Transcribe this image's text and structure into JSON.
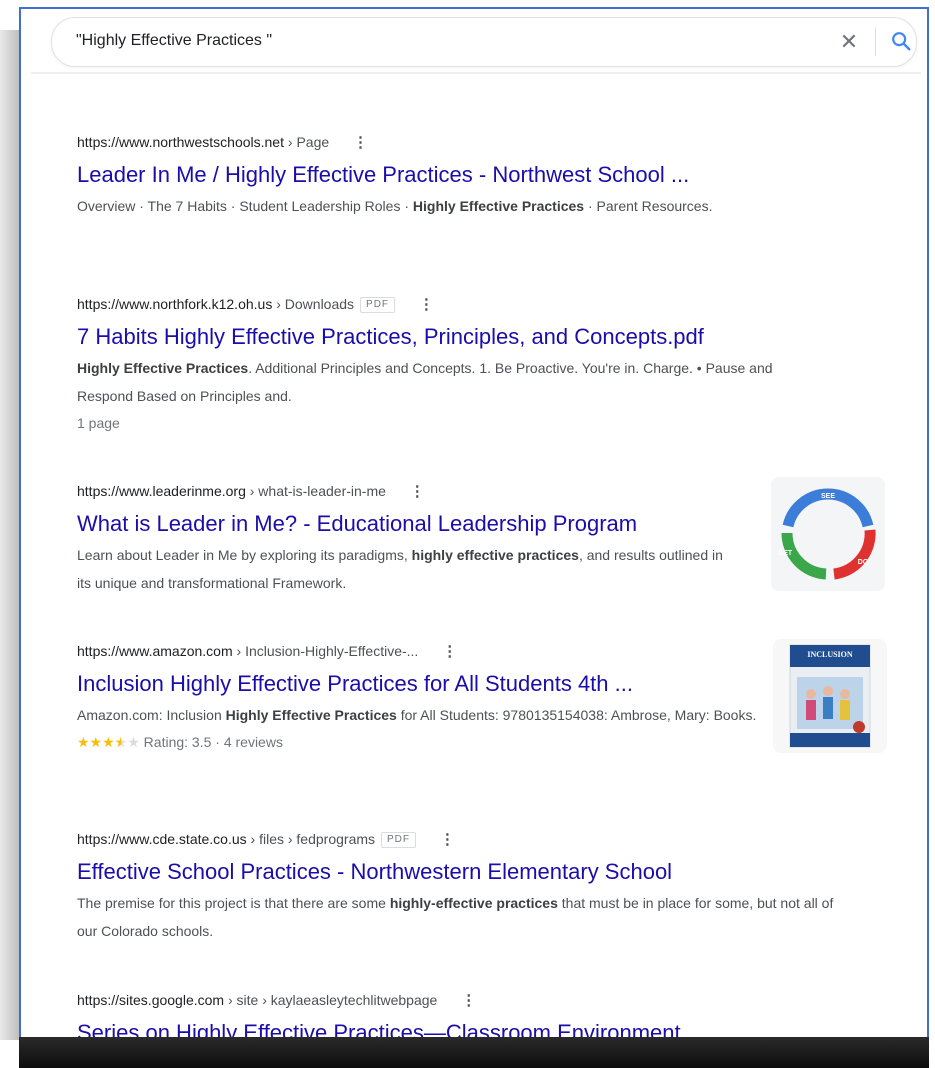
{
  "search": {
    "query": "\"Highly Effective Practices \"",
    "clear_icon": "close-icon",
    "search_icon": "search-icon"
  },
  "results": [
    {
      "site": "https://www.northwestschools.net",
      "path": " › Page",
      "title": "Leader In Me / Highly Effective Practices - Northwest School ...",
      "snippet_parts": [
        "Overview · The 7 Habits · Student Leadership Roles · ",
        "Highly Effective Practices",
        " · Parent Resources."
      ]
    },
    {
      "site": "https://www.northfork.k12.oh.us",
      "path": " › Downloads",
      "badge": "PDF",
      "title": "7 Habits Highly Effective Practices, Principles, and Concepts.pdf",
      "snippet_parts": [
        "",
        "Highly Effective Practices",
        ". Additional Principles and Concepts. 1. Be Proactive. You're in. Charge. • Pause and Respond Based on Principles and."
      ],
      "extra": "1 page"
    },
    {
      "site": "https://www.leaderinme.org",
      "path": " › what-is-leader-in-me",
      "title": "What is Leader in Me? - Educational Leadership Program",
      "snippet_parts": [
        "Learn about Leader in Me by exploring its paradigms, ",
        "highly effective practices",
        ", and results outlined in its unique and transformational Framework."
      ],
      "thumb_labels": [
        "SEE",
        "DO",
        "GET"
      ]
    },
    {
      "site": "https://www.amazon.com",
      "path": " › Inclusion-Highly-Effective-...",
      "title": "Inclusion Highly Effective Practices for All Students 4th ...",
      "snippet_parts": [
        "Amazon.com: Inclusion ",
        "Highly Effective Practices",
        " for All Students: 9780135154038: Ambrose, Mary: Books."
      ],
      "rating_text": "Rating: 3.5 · 4 reviews",
      "rating_value": 3.5,
      "thumb_title": "INCLUSION"
    },
    {
      "site": "https://www.cde.state.co.us",
      "path": " › files › fedprograms",
      "badge": "PDF",
      "title": "Effective School Practices - Northwestern Elementary School",
      "snippet_parts": [
        "The premise for this project is that there are some ",
        "highly-effective practices",
        " that must be in place for some, but not all of our Colorado schools."
      ]
    },
    {
      "site": "https://sites.google.com",
      "path": " › site › kaylaeasleytechlitwebpage",
      "title": "Series on Highly Effective Practices—Classroom Environment"
    }
  ],
  "colors": {
    "link": "#1a0dab",
    "frame_border": "#3f6fcf",
    "star": "#fbbc04"
  }
}
